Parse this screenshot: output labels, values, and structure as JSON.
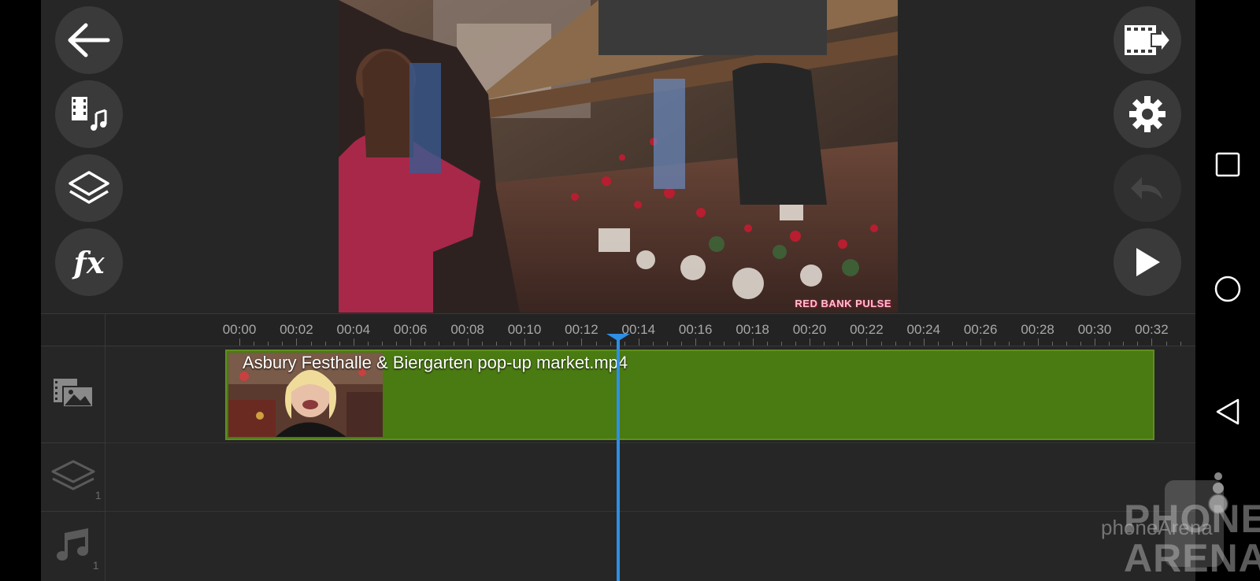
{
  "toolbar_left": {
    "back": {
      "icon": "arrow-left-icon"
    },
    "media": {
      "icon": "film-music-icon"
    },
    "layers": {
      "icon": "layers-icon"
    },
    "effects": {
      "icon": "fx-icon",
      "label": "fx"
    }
  },
  "toolbar_right": {
    "export": {
      "icon": "film-export-icon"
    },
    "settings": {
      "icon": "gear-icon"
    },
    "undo": {
      "icon": "undo-icon",
      "enabled": false
    },
    "play": {
      "icon": "play-icon"
    }
  },
  "preview": {
    "watermark": "RED BANK PULSE"
  },
  "timeline": {
    "ticks": [
      "00:00",
      "00:02",
      "00:04",
      "00:06",
      "00:08",
      "00:10",
      "00:12",
      "00:14",
      "00:16",
      "00:18",
      "00:20",
      "00:22",
      "00:24",
      "00:26",
      "00:28",
      "00:30",
      "00:32"
    ],
    "playhead_time": "00:13",
    "tracks": [
      {
        "icon": "media-track-icon",
        "badge": ""
      },
      {
        "icon": "layer-track-icon",
        "badge": "1"
      },
      {
        "icon": "audio-track-icon",
        "badge": "1"
      }
    ],
    "clip": {
      "title": "Asbury Festhalle & Biergarten pop-up market.mp4",
      "color": "#4a7a12"
    }
  },
  "system_nav": {
    "recents": "square-icon",
    "home": "circle-icon",
    "back": "triangle-back-icon"
  },
  "overlay_watermark": {
    "small": "phoneArena",
    "line1": "PHONE",
    "line2": "ARENA"
  },
  "colors": {
    "background": "#262626",
    "clip": "#4a7a12",
    "playhead": "#2e8fe6"
  }
}
